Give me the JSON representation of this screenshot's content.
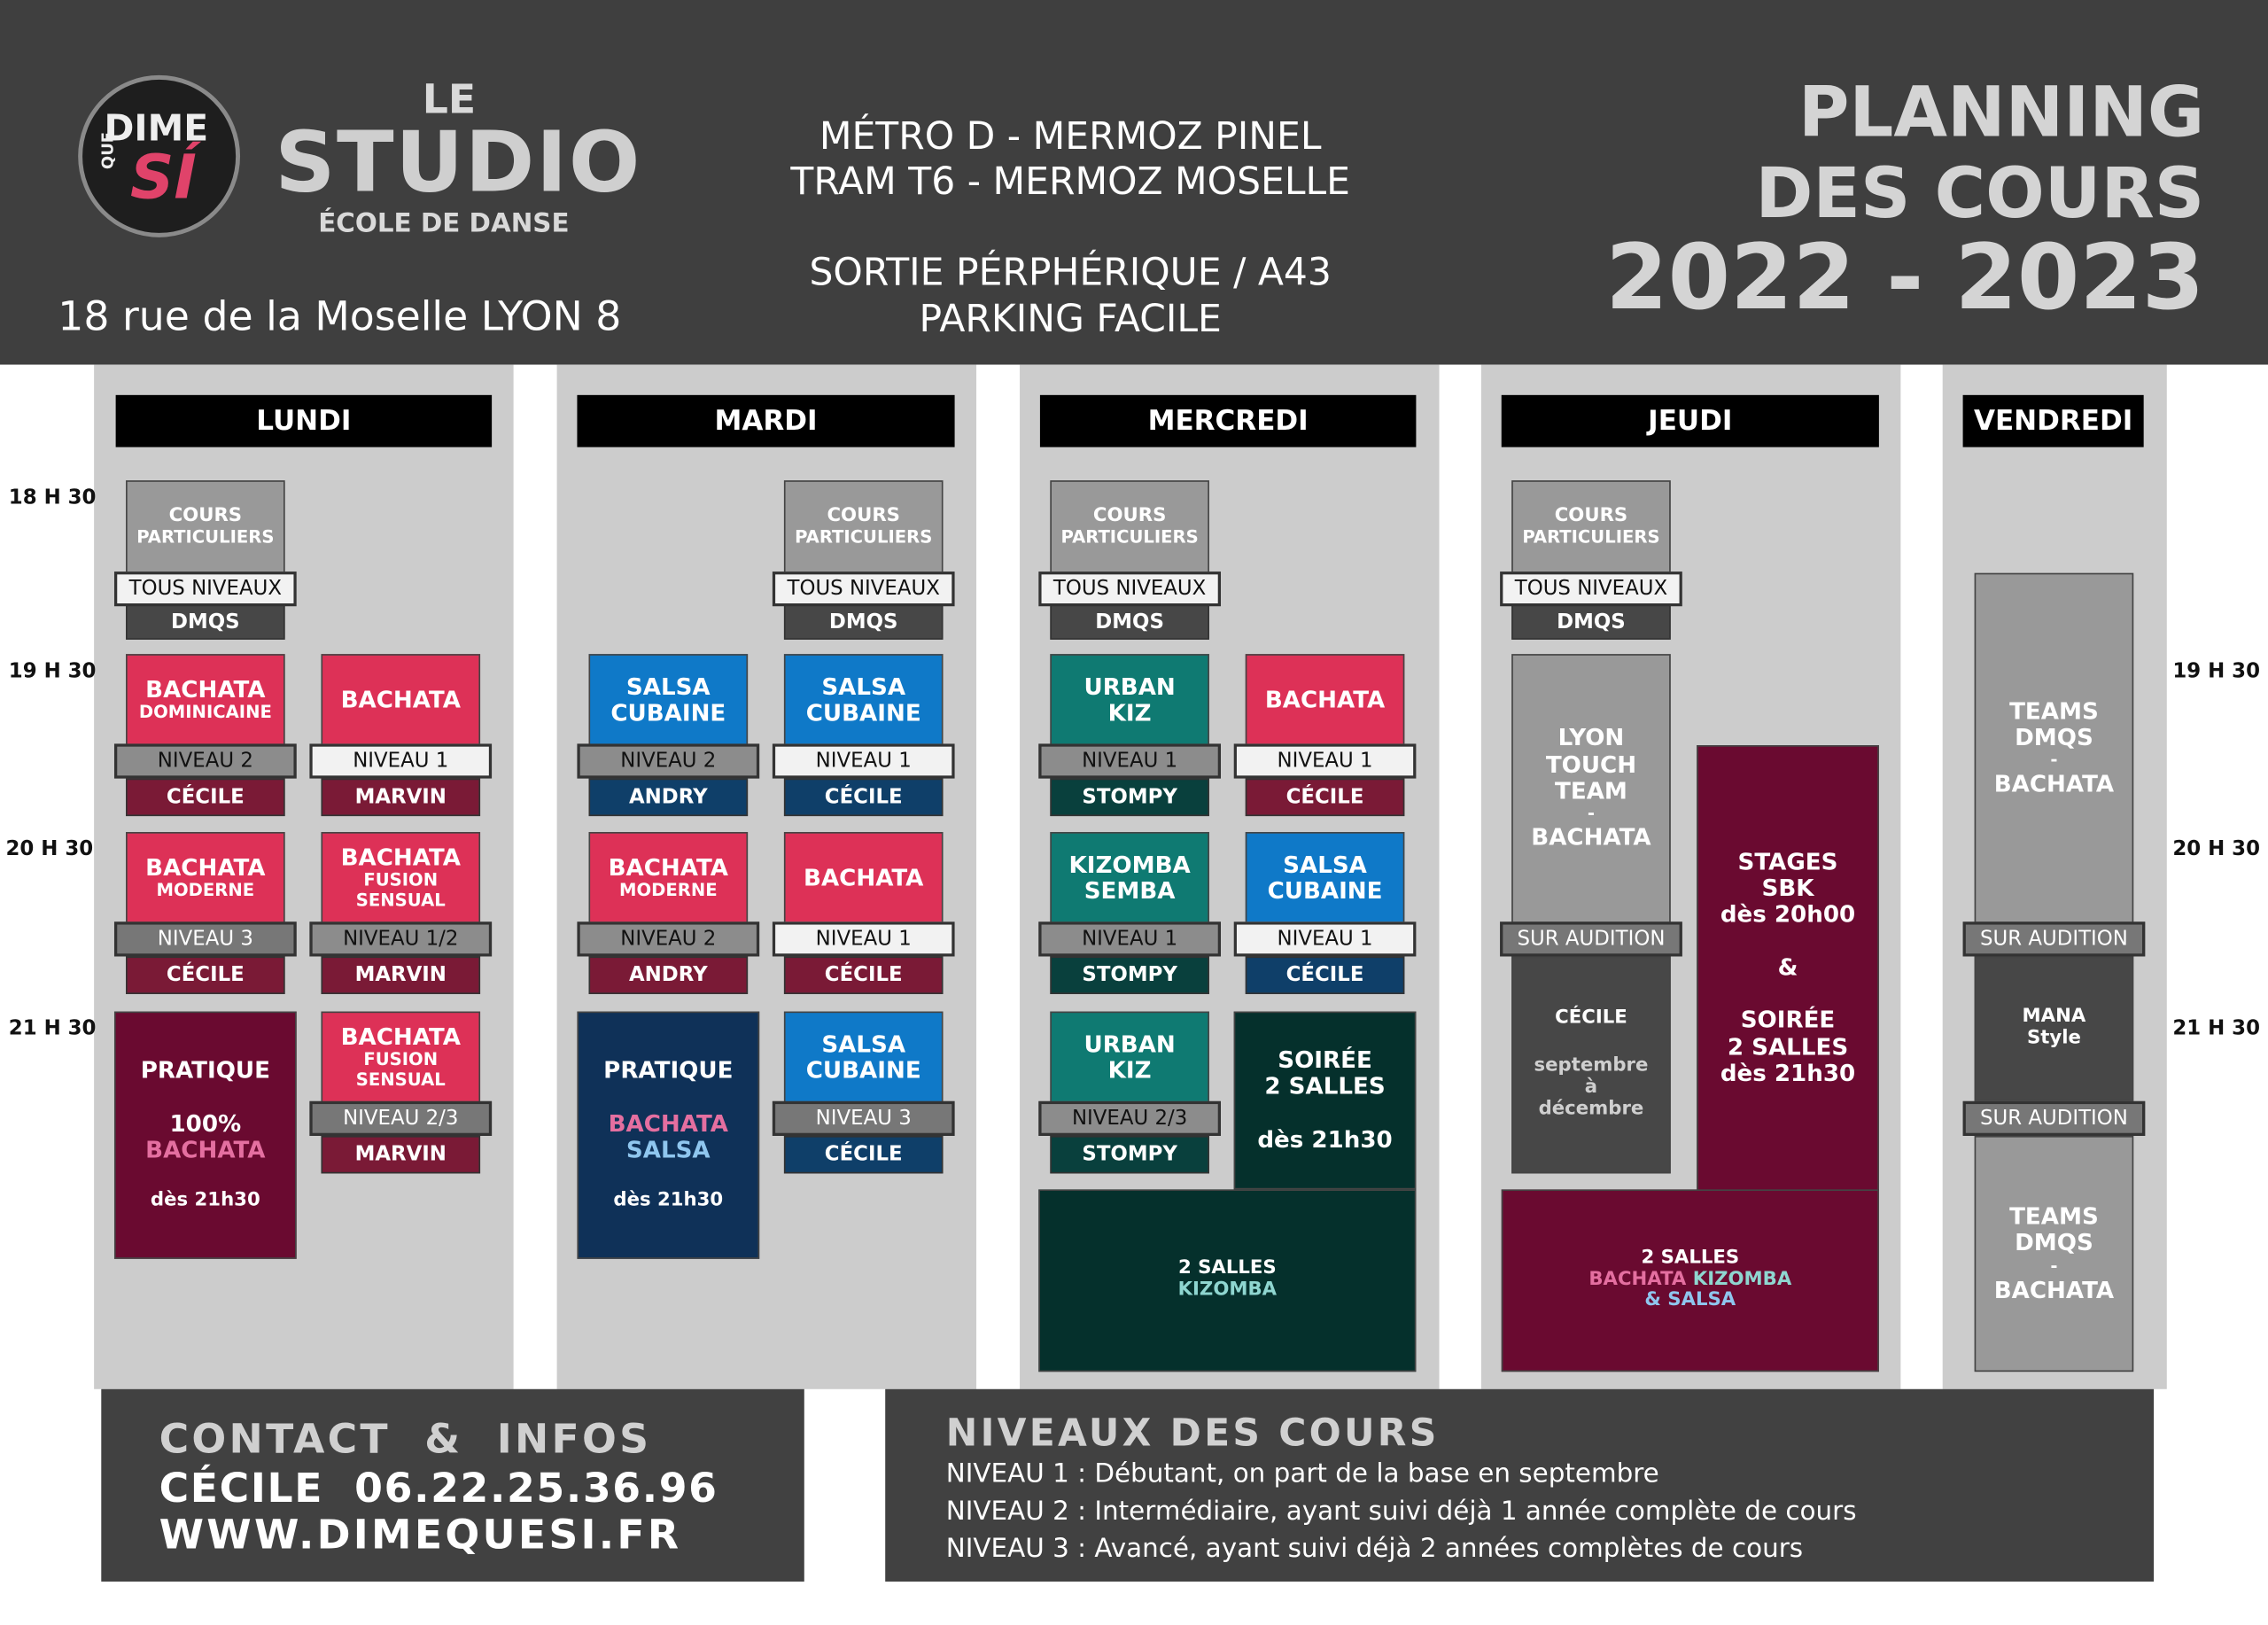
{
  "header": {
    "logo": {
      "dime": "DIME",
      "que": "QUE",
      "si": "SÍ"
    },
    "studio": {
      "le": "LE",
      "name": "STUDIO",
      "sub": "ÉCOLE DE DANSE"
    },
    "address": "18 rue de la Moselle LYON 8",
    "access_line1": "MÉTRO D - MERMOZ PINEL",
    "access_line2": "TRAM T6 - MERMOZ MOSELLE",
    "access_line3": "SORTIE PÉRPHÉRIQUE / A43",
    "access_line4": "PARKING FACILE",
    "title_line1": "PLANNING",
    "title_line2": "DES COURS",
    "title_line3": "2022 - 2023"
  },
  "days": {
    "lundi": "LUNDI",
    "mardi": "MARDI",
    "mercredi": "MERCREDI",
    "jeudi": "JEUDI",
    "vendredi": "VENDREDI"
  },
  "times": {
    "t1830": "18 H 30",
    "t1930": "19 H 30",
    "t2030": "20 H 30",
    "t2130": "21 H 30"
  },
  "common": {
    "cours": "COURS",
    "particuliers": "PARTICULIERS",
    "tous_niveaux": "TOUS NIVEAUX",
    "dmqs": "DMQS",
    "niveau1": "NIVEAU 1",
    "niveau2": "NIVEAU 2",
    "niveau3": "NIVEAU 3",
    "niveau12": "NIVEAU 1/2",
    "niveau23": "NIVEAU 2/3",
    "sur_audition": "SUR AUDITION",
    "bachata": "BACHATA",
    "salsa": "SALSA",
    "cubaine": "CUBAINE",
    "moderne": "MODERNE",
    "dominicaine": "DOMINICAINE",
    "fusion": "FUSION",
    "sensual": "SENSUAL",
    "pratique": "PRATIQUE",
    "des2130": "dès 21h30",
    "cecile": "CÉCILE",
    "marvin": "MARVIN",
    "andry": "ANDRY",
    "stompy": "STOMPY",
    "urban": "URBAN",
    "kiz": "KIZ",
    "kizomba": "KIZOMBA",
    "semba": "SEMBA",
    "soiree": "SOIRÉE",
    "soiree_caps": "SOIRÉE",
    "deux_salles": "2 SALLES",
    "teams": "TEAMS",
    "dash": "-",
    "mana": "MANA",
    "style": "Style",
    "lyon": "LYON",
    "touch": "TOUCH",
    "team": "TEAM",
    "septembre": "septembre",
    "a": "à",
    "decembre": "décembre",
    "stages": "STAGES",
    "sbk": "SBK",
    "des2000": "dès 20h00",
    "amp": "&",
    "soiree_des": "dès 21h30",
    "cent_pct": "100%",
    "amp_salsa": "& SALSA"
  },
  "contact": {
    "title": "CONTACT  &  INFOS",
    "line1": "CÉCILE  06.22.25.36.96",
    "line2": "WWW.DIMEQUESI.FR"
  },
  "niveaux": {
    "title": "NIVEAUX DES COURS",
    "n1": "NIVEAU 1 : Débutant, on part de la base en septembre",
    "n2": "NIVEAU 2 : Intermédiaire, ayant suivi déjà 1 année complète de cours",
    "n3": "NIVEAU 3 : Avancé, ayant suivi déjà 2 années complètes de cours"
  },
  "colors": {
    "header_bg": "#3f3f3f",
    "column_bg": "#cccccc",
    "bachata_pink": "#dd3157",
    "salsa_blue": "#0f79c8",
    "kiz_teal": "#0f7a72",
    "pratique_maroon": "#6a0a30"
  }
}
